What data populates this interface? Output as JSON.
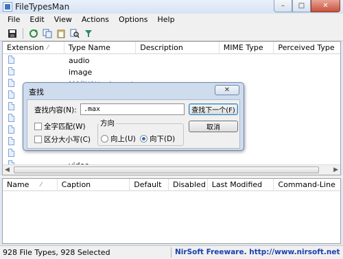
{
  "window": {
    "title": "FileTypesMan",
    "minimize": "–",
    "maximize": "□",
    "close": "✕"
  },
  "menu": [
    "File",
    "Edit",
    "View",
    "Actions",
    "Options",
    "Help"
  ],
  "toolbar": {
    "icons": [
      "save-icon",
      "refresh-icon",
      "copy-icon",
      "paste-icon",
      "find-icon",
      "filter-icon"
    ]
  },
  "upper_list": {
    "columns": [
      "Extension",
      "Type Name",
      "Description",
      "MIME Type",
      "Perceived Type"
    ],
    "rows": [
      {
        "type_name": "audio"
      },
      {
        "type_name": "image"
      },
      {
        "type_name": "MAPI/Attachment"
      },
      {
        "type_name": ""
      },
      {
        "type_name": ""
      },
      {
        "type_name": ""
      },
      {
        "type_name": ""
      },
      {
        "type_name": ""
      },
      {
        "type_name": ""
      },
      {
        "type_name": "video"
      }
    ]
  },
  "lower_list": {
    "columns": [
      "Name",
      "Caption",
      "Default",
      "Disabled",
      "Last Modified",
      "Command-Line"
    ]
  },
  "status": {
    "left": "928 File Types, 928 Selected",
    "right": "NirSoft Freeware.  http://www.nirsoft.net"
  },
  "find_dialog": {
    "title": "查找",
    "close_glyph": "✕",
    "find_label": "查找内容(N):",
    "find_value": ".max",
    "find_next": "查找下一个(F)",
    "cancel": "取消",
    "match_whole": "全字匹配(W)",
    "match_case": "区分大小写(C)",
    "direction_label": "方向",
    "up": "向上(U)",
    "down": "向下(D)",
    "direction_selected": "down"
  }
}
